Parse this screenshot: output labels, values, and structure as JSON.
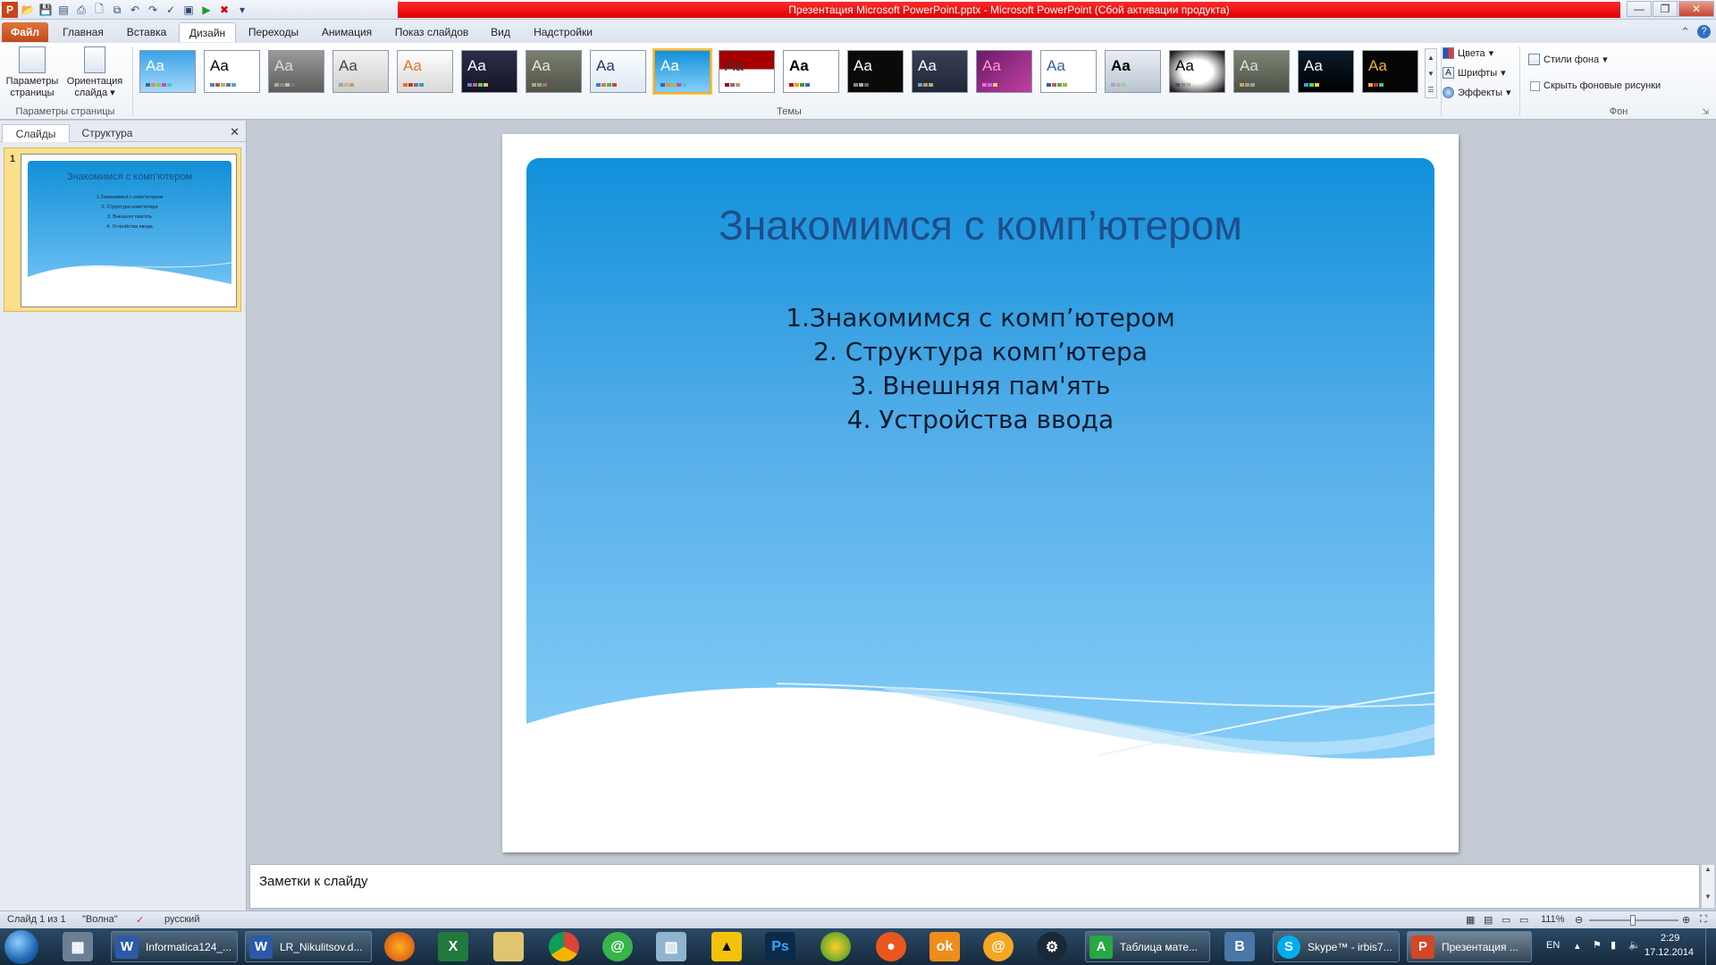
{
  "window": {
    "title": "Презентация Microsoft PowerPoint.pptx  -  Microsoft PowerPoint (Сбой активации продукта)"
  },
  "tabs": {
    "file": "Файл",
    "home": "Главная",
    "insert": "Вставка",
    "design": "Дизайн",
    "transitions": "Переходы",
    "animation": "Анимация",
    "slideshow": "Показ слайдов",
    "view": "Вид",
    "addins": "Надстройки"
  },
  "ribbon": {
    "page_setup_label": "Параметры страницы",
    "page_setup_line1": "Параметры",
    "page_setup_line2": "страницы",
    "orientation_line1": "Ориентация",
    "orientation_line2": "слайда",
    "themes_group_label": "Темы",
    "theme_sample": "Aa",
    "colors_label": "Цвета",
    "fonts_label": "Шрифты",
    "effects_label": "Эффекты",
    "bg_styles_label": "Стили фона",
    "hide_bg_label": "Скрыть фоновые рисунки",
    "bg_group_label": "Фон"
  },
  "left_panel": {
    "tab_slides": "Слайды",
    "tab_outline": "Структура",
    "slide_number": "1"
  },
  "slide": {
    "title": "Знакомимся с комп’ютером",
    "items": [
      "1.Знакомимся с комп’ютером",
      "2. Структура комп’ютера",
      "3. Внешняя пам'ять",
      "4. Устройства ввода"
    ]
  },
  "notes": {
    "placeholder": "Заметки к слайду"
  },
  "status": {
    "slide_info": "Слайд 1 из 1",
    "theme_name": "\"Волна\"",
    "language": "русский",
    "zoom": "111%"
  },
  "taskbar": {
    "items": [
      {
        "label": "Informatica124_..."
      },
      {
        "label": "LR_Nikulitsov.d..."
      },
      {
        "label": "Таблица мате..."
      },
      {
        "label": "Skype™ - irbis7..."
      },
      {
        "label": "Презентация ..."
      }
    ],
    "lang": "EN",
    "time": "2:29",
    "date": "17.12.2014"
  }
}
